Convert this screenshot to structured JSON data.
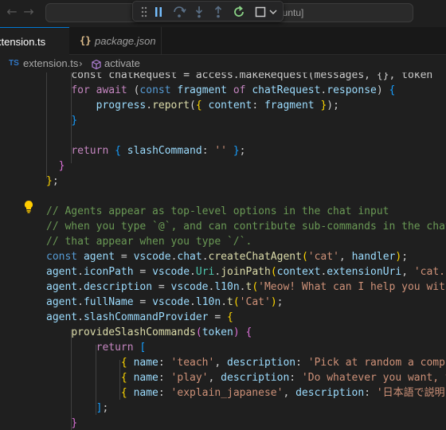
{
  "titlebar": {
    "back_icon": "arrow-left-icon",
    "forward_icon": "arrow-right-icon",
    "command_center_text": "buntu]",
    "debug_toolbar": {
      "items": [
        "drag-handle-icon",
        "pause-icon",
        "step-over-icon",
        "step-into-icon",
        "step-out-icon",
        "restart-icon",
        "stop-icon",
        "chevron-down-icon"
      ],
      "restart_color": "#89d185",
      "step_color": "#75beff"
    }
  },
  "tabs": {
    "active": {
      "label": "xtension.ts"
    },
    "inactive": {
      "icon_text": "{}",
      "label": "package.json"
    }
  },
  "breadcrumb": {
    "file_badge": "TS",
    "file": "extension.ts",
    "separator": "›",
    "symbol_icon": "cube-icon",
    "symbol": "activate"
  },
  "editor": {
    "lightbulb_icon": "lightbulb-icon",
    "lines": [
      [
        [
          "",
          "d",
          "    "
        ],
        [
          "const chatRequest = access.makeRequest(messages, {}, token",
          "d",
          ""
        ]
      ],
      [
        [
          "",
          "d",
          "    "
        ],
        [
          "for await",
          "c",
          ""
        ],
        [
          " (",
          "d",
          ""
        ],
        [
          "const",
          "k",
          ""
        ],
        [
          " fragment ",
          "v",
          ""
        ],
        [
          "of",
          "c",
          ""
        ],
        [
          " chatRequest",
          "v",
          ""
        ],
        [
          ".",
          "d",
          ""
        ],
        [
          "response",
          "v",
          ""
        ],
        [
          ") ",
          "d",
          ""
        ],
        [
          "{",
          "b",
          ""
        ]
      ],
      [
        [
          "",
          "d",
          "        "
        ],
        [
          "progress",
          "v",
          ""
        ],
        [
          ".",
          "d",
          ""
        ],
        [
          "report",
          "f",
          ""
        ],
        [
          "(",
          "d",
          ""
        ],
        [
          "{",
          "y",
          ""
        ],
        [
          " content",
          "v",
          ""
        ],
        [
          ": ",
          "d",
          ""
        ],
        [
          "fragment",
          "v",
          ""
        ],
        [
          " ",
          "d",
          ""
        ],
        [
          "}",
          "y",
          ""
        ],
        [
          ");",
          "d",
          ""
        ]
      ],
      [
        [
          "",
          "d",
          "    "
        ],
        [
          "}",
          "b",
          ""
        ]
      ],
      [
        [
          "",
          "d",
          ""
        ]
      ],
      [
        [
          "",
          "d",
          "    "
        ],
        [
          "return",
          "c",
          ""
        ],
        [
          " ",
          "d",
          ""
        ],
        [
          "{",
          "b",
          ""
        ],
        [
          " slashCommand",
          "v",
          ""
        ],
        [
          ": ",
          "d",
          ""
        ],
        [
          "''",
          "s",
          ""
        ],
        [
          " ",
          "d",
          ""
        ],
        [
          "}",
          "b",
          ""
        ],
        [
          ";",
          "d",
          ""
        ]
      ],
      [
        [
          "",
          "d",
          "  "
        ],
        [
          "}",
          "p",
          ""
        ]
      ],
      [
        [
          "}",
          "y",
          ""
        ],
        [
          ";",
          "d",
          ""
        ]
      ],
      [
        [
          "",
          "d",
          ""
        ]
      ],
      [
        [
          "// Agents appear as top-level options in the chat input",
          "m",
          ""
        ]
      ],
      [
        [
          "// when you type `@`, and can contribute sub-commands in the chat",
          "m",
          ""
        ]
      ],
      [
        [
          "// that appear when you type `/`.",
          "m",
          ""
        ]
      ],
      [
        [
          "const",
          "k",
          ""
        ],
        [
          " agent",
          "v",
          ""
        ],
        [
          " = ",
          "d",
          ""
        ],
        [
          "vscode",
          "v",
          ""
        ],
        [
          ".",
          "d",
          ""
        ],
        [
          "chat",
          "v",
          ""
        ],
        [
          ".",
          "d",
          ""
        ],
        [
          "createChatAgent",
          "f",
          ""
        ],
        [
          "(",
          "y",
          ""
        ],
        [
          "'cat'",
          "s",
          ""
        ],
        [
          ", ",
          "d",
          ""
        ],
        [
          "handler",
          "v",
          ""
        ],
        [
          ")",
          "y",
          ""
        ],
        [
          ";",
          "d",
          ""
        ]
      ],
      [
        [
          "agent",
          "v",
          ""
        ],
        [
          ".",
          "d",
          ""
        ],
        [
          "iconPath",
          "v",
          ""
        ],
        [
          " = ",
          "d",
          ""
        ],
        [
          "vscode",
          "v",
          ""
        ],
        [
          ".",
          "d",
          ""
        ],
        [
          "Uri",
          "t",
          ""
        ],
        [
          ".",
          "d",
          ""
        ],
        [
          "joinPath",
          "f",
          ""
        ],
        [
          "(",
          "y",
          ""
        ],
        [
          "context",
          "v",
          ""
        ],
        [
          ".",
          "d",
          ""
        ],
        [
          "extensionUri",
          "v",
          ""
        ],
        [
          ", ",
          "d",
          ""
        ],
        [
          "'cat.jpeg'",
          "s",
          ""
        ]
      ],
      [
        [
          "agent",
          "v",
          ""
        ],
        [
          ".",
          "d",
          ""
        ],
        [
          "description",
          "v",
          ""
        ],
        [
          " = ",
          "d",
          ""
        ],
        [
          "vscode",
          "v",
          ""
        ],
        [
          ".",
          "d",
          ""
        ],
        [
          "l10n",
          "v",
          ""
        ],
        [
          ".",
          "d",
          ""
        ],
        [
          "t",
          "f",
          ""
        ],
        [
          "(",
          "y",
          ""
        ],
        [
          "'Meow! What can I help you with?'",
          "s",
          ""
        ]
      ],
      [
        [
          "agent",
          "v",
          ""
        ],
        [
          ".",
          "d",
          ""
        ],
        [
          "fullName",
          "v",
          ""
        ],
        [
          " = ",
          "d",
          ""
        ],
        [
          "vscode",
          "v",
          ""
        ],
        [
          ".",
          "d",
          ""
        ],
        [
          "l10n",
          "v",
          ""
        ],
        [
          ".",
          "d",
          ""
        ],
        [
          "t",
          "f",
          ""
        ],
        [
          "(",
          "y",
          ""
        ],
        [
          "'Cat'",
          "s",
          ""
        ],
        [
          ")",
          "y",
          ""
        ],
        [
          ";",
          "d",
          ""
        ]
      ],
      [
        [
          "agent",
          "v",
          ""
        ],
        [
          ".",
          "d",
          ""
        ],
        [
          "slashCommandProvider",
          "v",
          ""
        ],
        [
          " = ",
          "d",
          ""
        ],
        [
          "{",
          "y",
          ""
        ]
      ],
      [
        [
          "",
          "d",
          "    "
        ],
        [
          "provideSlashCommands",
          "f",
          ""
        ],
        [
          "(",
          "p",
          ""
        ],
        [
          "token",
          "v",
          ""
        ],
        [
          ")",
          "p",
          ""
        ],
        [
          " ",
          "d",
          ""
        ],
        [
          "{",
          "p",
          ""
        ]
      ],
      [
        [
          "",
          "d",
          "        "
        ],
        [
          "return",
          "c",
          ""
        ],
        [
          " ",
          "d",
          ""
        ],
        [
          "[",
          "b",
          ""
        ]
      ],
      [
        [
          "",
          "d",
          "            "
        ],
        [
          "{",
          "y",
          ""
        ],
        [
          " name",
          "v",
          ""
        ],
        [
          ": ",
          "d",
          ""
        ],
        [
          "'teach'",
          "s",
          ""
        ],
        [
          ", ",
          "d",
          ""
        ],
        [
          "description",
          "v",
          ""
        ],
        [
          ": ",
          "d",
          ""
        ],
        [
          "'Pick at random a computer science concept'",
          "s",
          ""
        ]
      ],
      [
        [
          "",
          "d",
          "            "
        ],
        [
          "{",
          "y",
          ""
        ],
        [
          " name",
          "v",
          ""
        ],
        [
          ": ",
          "d",
          ""
        ],
        [
          "'play'",
          "s",
          ""
        ],
        [
          ", ",
          "d",
          ""
        ],
        [
          "description",
          "v",
          ""
        ],
        [
          ": ",
          "d",
          ""
        ],
        [
          "'Do whatever you want, you are a cat'",
          "s",
          ""
        ]
      ],
      [
        [
          "",
          "d",
          "            "
        ],
        [
          "{",
          "y",
          ""
        ],
        [
          " name",
          "v",
          ""
        ],
        [
          ": ",
          "d",
          ""
        ],
        [
          "'explain_japanese'",
          "s",
          ""
        ],
        [
          ", ",
          "d",
          ""
        ],
        [
          "description",
          "v",
          ""
        ],
        [
          ": ",
          "d",
          ""
        ],
        [
          "'日本語で説明",
          "s",
          ""
        ]
      ],
      [
        [
          "",
          "d",
          "        "
        ],
        [
          "]",
          "b",
          ""
        ],
        [
          ";",
          "d",
          ""
        ]
      ],
      [
        [
          "",
          "d",
          "    "
        ],
        [
          "}",
          "p",
          ""
        ]
      ]
    ]
  }
}
